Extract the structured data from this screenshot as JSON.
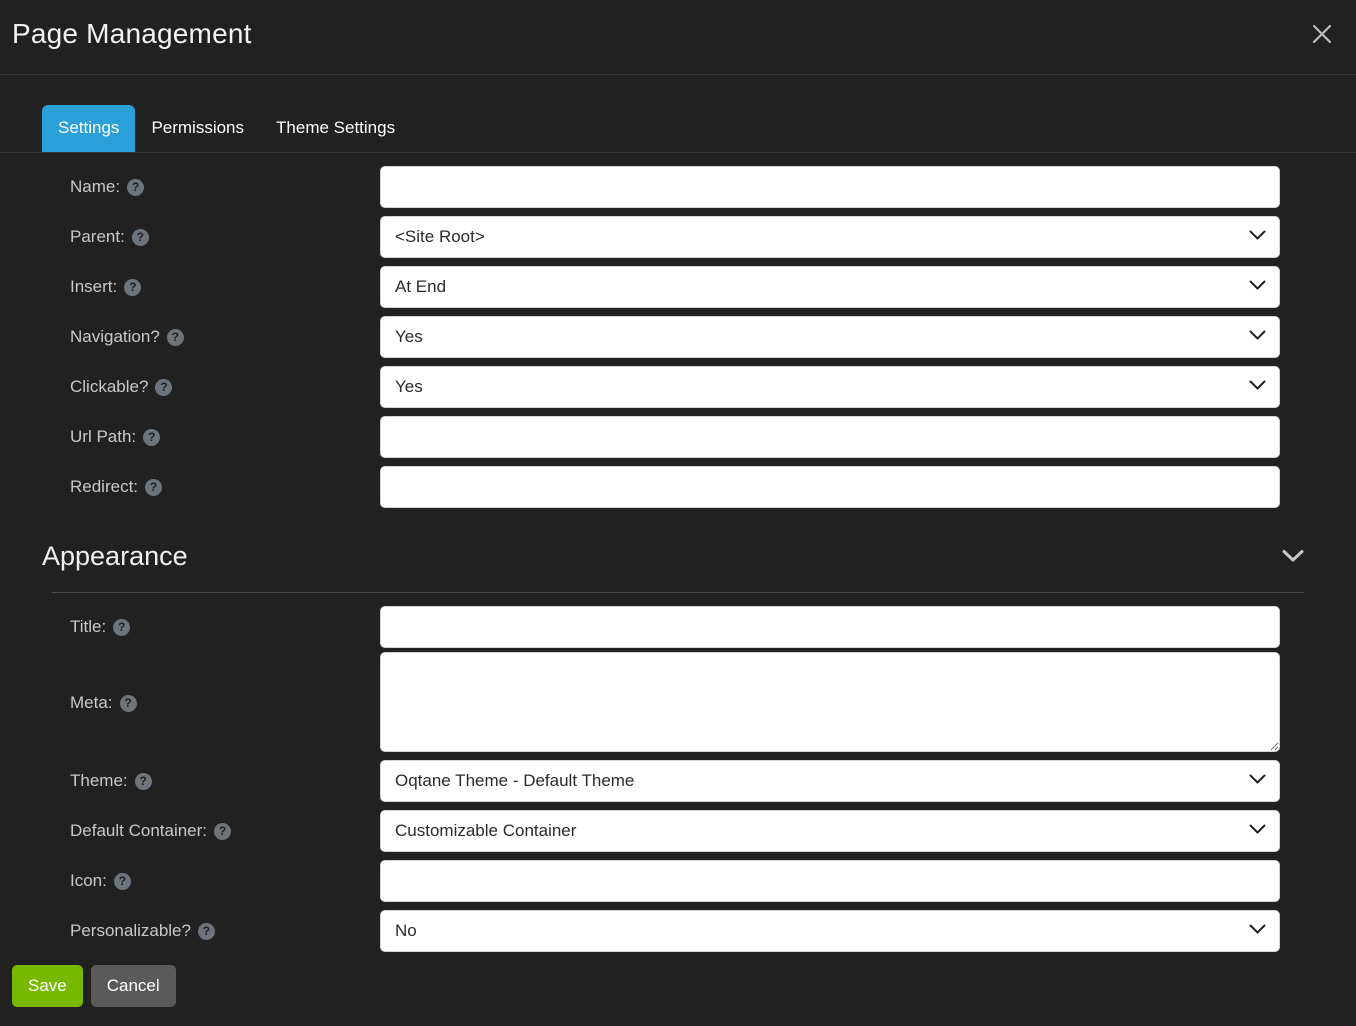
{
  "header": {
    "title": "Page Management",
    "close_icon": "close-icon"
  },
  "tabs": [
    {
      "label": "Settings",
      "active": true
    },
    {
      "label": "Permissions",
      "active": false
    },
    {
      "label": "Theme Settings",
      "active": false
    }
  ],
  "help_glyph": "?",
  "settings": {
    "name": {
      "label": "Name:",
      "value": "",
      "type": "text"
    },
    "parent": {
      "label": "Parent:",
      "value": "<Site Root>",
      "type": "select"
    },
    "insert": {
      "label": "Insert:",
      "value": "At End",
      "type": "select"
    },
    "navigation": {
      "label": "Navigation?",
      "value": "Yes",
      "type": "select"
    },
    "clickable": {
      "label": "Clickable?",
      "value": "Yes",
      "type": "select"
    },
    "url_path": {
      "label": "Url Path:",
      "value": "",
      "type": "text"
    },
    "redirect": {
      "label": "Redirect:",
      "value": "",
      "type": "text"
    }
  },
  "appearance": {
    "heading": "Appearance",
    "toggle_icon": "chevron-down-icon",
    "title": {
      "label": "Title:",
      "value": "",
      "type": "text"
    },
    "meta": {
      "label": "Meta:",
      "value": "",
      "type": "textarea"
    },
    "theme": {
      "label": "Theme:",
      "value": "Oqtane Theme - Default Theme",
      "type": "select"
    },
    "default_container": {
      "label": "Default Container:",
      "value": "Customizable Container",
      "type": "select"
    },
    "icon": {
      "label": "Icon:",
      "value": "",
      "type": "text"
    },
    "personalizable": {
      "label": "Personalizable?",
      "value": "No",
      "type": "select"
    }
  },
  "footer": {
    "save_label": "Save",
    "cancel_label": "Cancel"
  },
  "colors": {
    "background": "#212121",
    "tab_active": "#2b9fd8",
    "save": "#77b900",
    "cancel": "#5a5a5a",
    "help_badge": "#6c757d",
    "label_text": "#c9c9c9"
  }
}
